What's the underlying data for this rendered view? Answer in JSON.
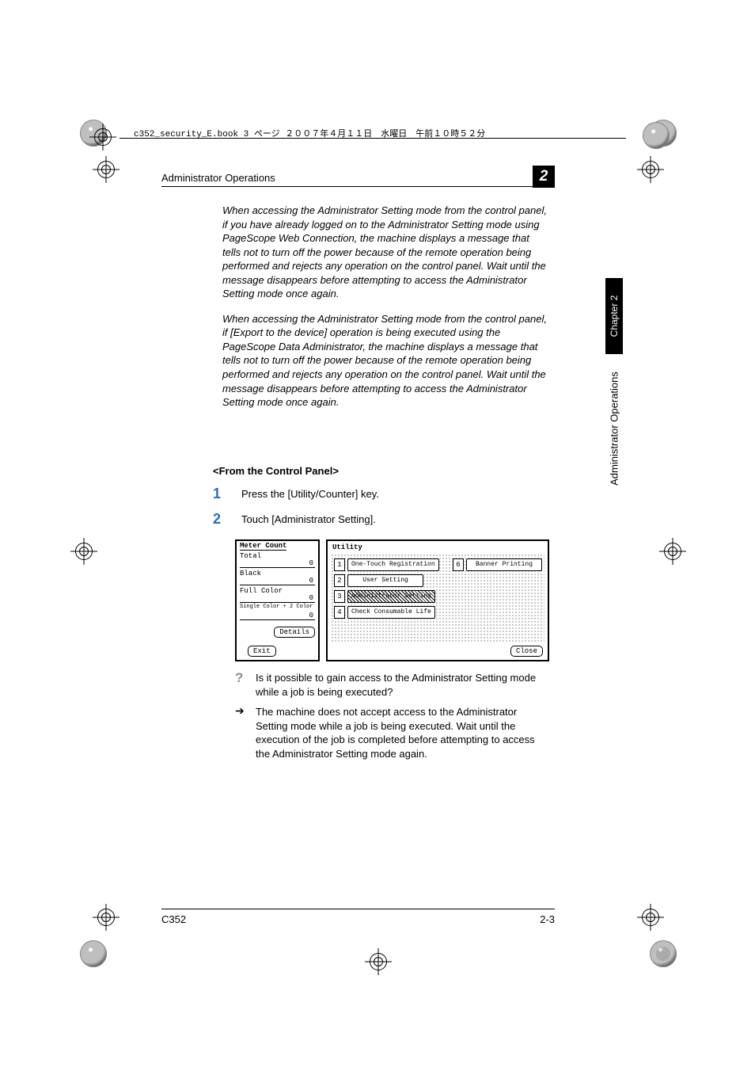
{
  "print_header": "c352_security_E.book  3 ページ  ２００７年４月１１日　水曜日　午前１０時５２分",
  "running_head": "Administrator Operations",
  "chapter_number": "2",
  "side_tab": "Chapter 2",
  "side_vertical": "Administrator Operations",
  "para1": "When accessing the Administrator Setting mode from the control panel, if you have already logged on to the Administrator Setting mode using PageScope Web Connection, the machine displays a message that tells not to turn off the power because of the remote operation being performed and rejects any operation on the control panel. Wait until the message disappears before attempting to access the Administrator Setting mode once again.",
  "para2": "When accessing the Administrator Setting mode from the control panel, if [Export to the device] operation is being executed using the PageScope Data Administrator, the machine displays a message that tells not to turn off the power because of the remote operation being performed and rejects any operation on the control panel. Wait until the message disappears before attempting to access the Administrator Setting mode once again.",
  "subhead": "<From the Control Panel>",
  "steps": [
    {
      "n": "1",
      "text": "Press the [Utility/Counter] key."
    },
    {
      "n": "2",
      "text": "Touch [Administrator Setting]."
    }
  ],
  "panel": {
    "meter": {
      "title": "Meter Count",
      "rows": [
        {
          "label": "Total",
          "value": "0"
        },
        {
          "label": "Black",
          "value": "0"
        },
        {
          "label": "Full Color",
          "value": "0"
        },
        {
          "label": "Single Color + 2 Color",
          "value": "0"
        }
      ],
      "details_btn": "Details",
      "exit_btn": "Exit"
    },
    "utility": {
      "title": "Utility",
      "items": [
        {
          "n": "1",
          "label": "One-Touch Registration"
        },
        {
          "n": "2",
          "label": "User Setting"
        },
        {
          "n": "3",
          "label": "Administrator Setting",
          "selected": true
        },
        {
          "n": "4",
          "label": "Check Consumable Life"
        },
        {
          "n": "6",
          "label": "Banner Printing"
        }
      ],
      "close_btn": "Close"
    }
  },
  "qa": {
    "question": "Is it possible to gain access to the Administrator Setting mode while a job is being executed?",
    "answer": "The machine does not accept access to the Administrator Setting mode while a job is being executed. Wait until the execution of the job is completed before attempting to access the Administrator Setting mode again."
  },
  "footer": {
    "left": "C352",
    "right": "2-3"
  }
}
